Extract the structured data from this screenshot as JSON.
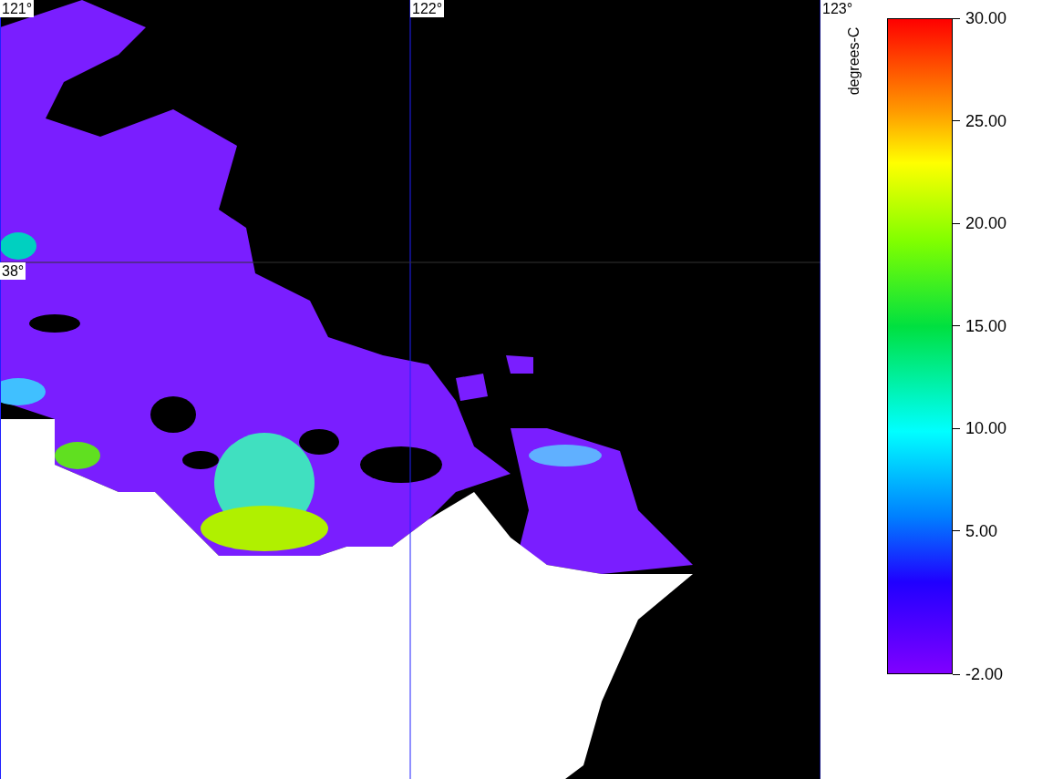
{
  "map": {
    "longitude_labels": [
      "121°",
      "122°",
      "123°"
    ],
    "latitude_labels": [
      "38°"
    ]
  },
  "legend": {
    "unit": "degrees-C",
    "ticks": [
      {
        "label": "30.00"
      },
      {
        "label": "25.00"
      },
      {
        "label": "20.00"
      },
      {
        "label": "15.00"
      },
      {
        "label": "10.00"
      },
      {
        "label": "5.00"
      },
      {
        "label": "-2.00"
      }
    ]
  }
}
